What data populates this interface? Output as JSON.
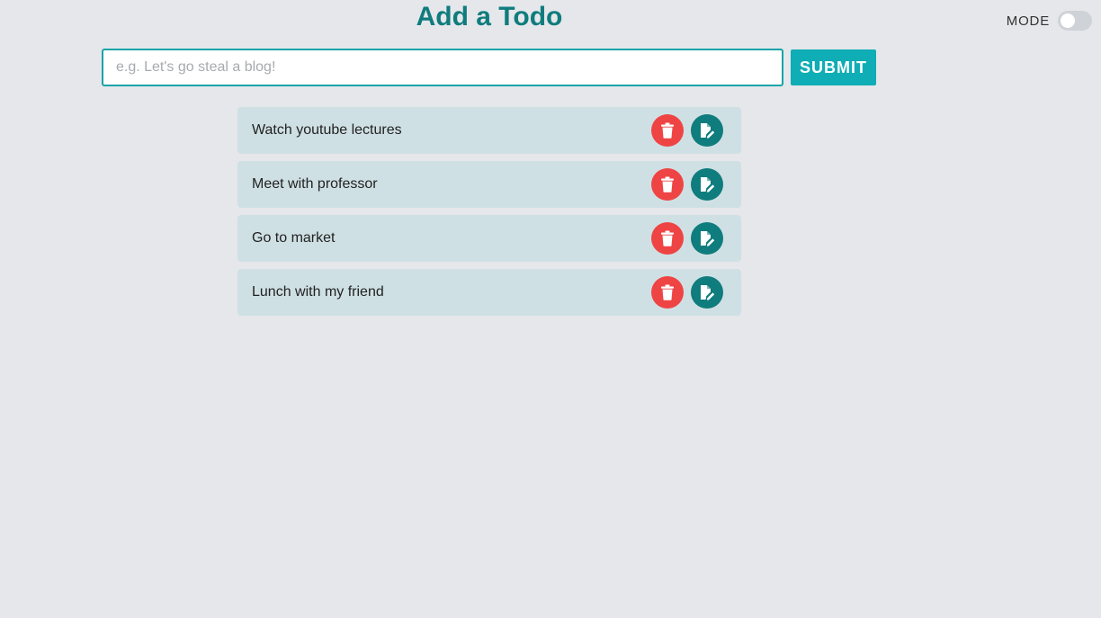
{
  "header": {
    "title": "Add a Todo",
    "mode_label": "MODE",
    "mode_on": false
  },
  "form": {
    "placeholder": "e.g. Let's go steal a blog!",
    "value": "",
    "submit_label": "SUBMIT"
  },
  "todos": [
    {
      "text": "Watch youtube lectures",
      "delete_icon": "trash-icon",
      "edit_icon": "edit-document-icon"
    },
    {
      "text": "Meet with professor",
      "delete_icon": "trash-icon",
      "edit_icon": "edit-document-icon"
    },
    {
      "text": "Go to market",
      "delete_icon": "trash-icon",
      "edit_icon": "edit-document-icon"
    },
    {
      "text": "Lunch with my friend",
      "delete_icon": "trash-icon",
      "edit_icon": "edit-document-icon"
    }
  ],
  "colors": {
    "background": "#e5e7eb",
    "accent": "#0f7c7d",
    "submit": "#0fadb5",
    "delete": "#ef4444",
    "item_background": "#cfe0e4"
  }
}
